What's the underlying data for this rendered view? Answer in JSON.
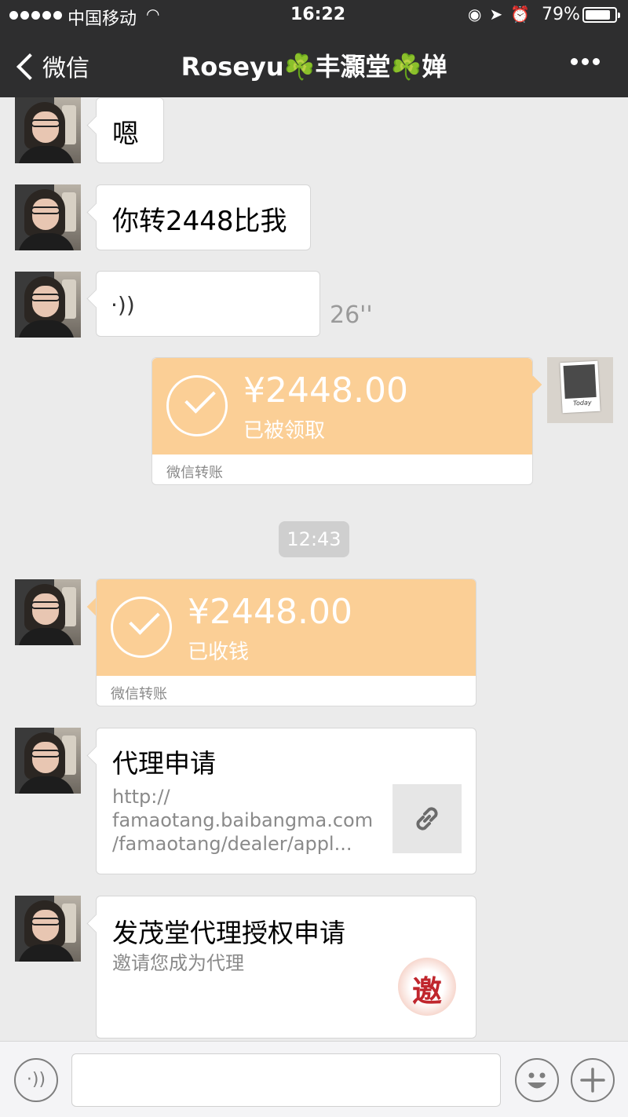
{
  "status": {
    "carrier": "中国移动",
    "time": "16:22",
    "battery": "79%"
  },
  "nav": {
    "back_label": "微信",
    "title": "Roseyu☘️丰灝堂☘️婵"
  },
  "messages": {
    "m1": "嗯",
    "m2": "你转2448比我",
    "voice_duration": "26''",
    "transfer_sent": {
      "amount": "¥2448.00",
      "status": "已被领取",
      "label": "微信转账"
    },
    "time_divider": "12:43",
    "transfer_received": {
      "amount": "¥2448.00",
      "status": "已收钱",
      "label": "微信转账"
    },
    "link": {
      "title": "代理申请",
      "url_lines": [
        "http://",
        "famaotang.baibangma.com",
        "/famaotang/dealer/appl..."
      ]
    },
    "invite": {
      "title": "发茂堂代理授权申请",
      "subtitle": "邀请您成为代理",
      "icon_char": "邀"
    }
  },
  "icons": {
    "voice": "voice-wave-icon",
    "emoji": "smiley-icon",
    "plus": "plus-icon",
    "link": "link-icon"
  }
}
